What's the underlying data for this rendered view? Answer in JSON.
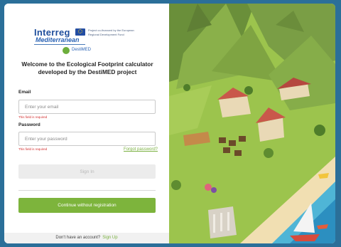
{
  "logo": {
    "brand": "Interreg",
    "sub": "Mediterranean",
    "fund_text": "Project co-financed by the European Regional Development Fund",
    "project": "DestiMED"
  },
  "welcome_title": "Welcome to the Ecological Footprint calculator developed by the DestiMED project",
  "form": {
    "email_label": "Email",
    "email_placeholder": "Enter your email",
    "email_error": "This field is required",
    "password_label": "Password",
    "password_placeholder": "Enter your password",
    "password_error": "This field is required",
    "forgot_link": "Forgot password?",
    "signin_label": "Sign In",
    "continue_label": "Continue without registration"
  },
  "footer": {
    "prompt": "Don't have an account?",
    "signup_link": "Sign Up"
  },
  "colors": {
    "accent_green": "#7db43c",
    "error_red": "#d32f2f",
    "brand_blue": "#1f4e9c"
  }
}
